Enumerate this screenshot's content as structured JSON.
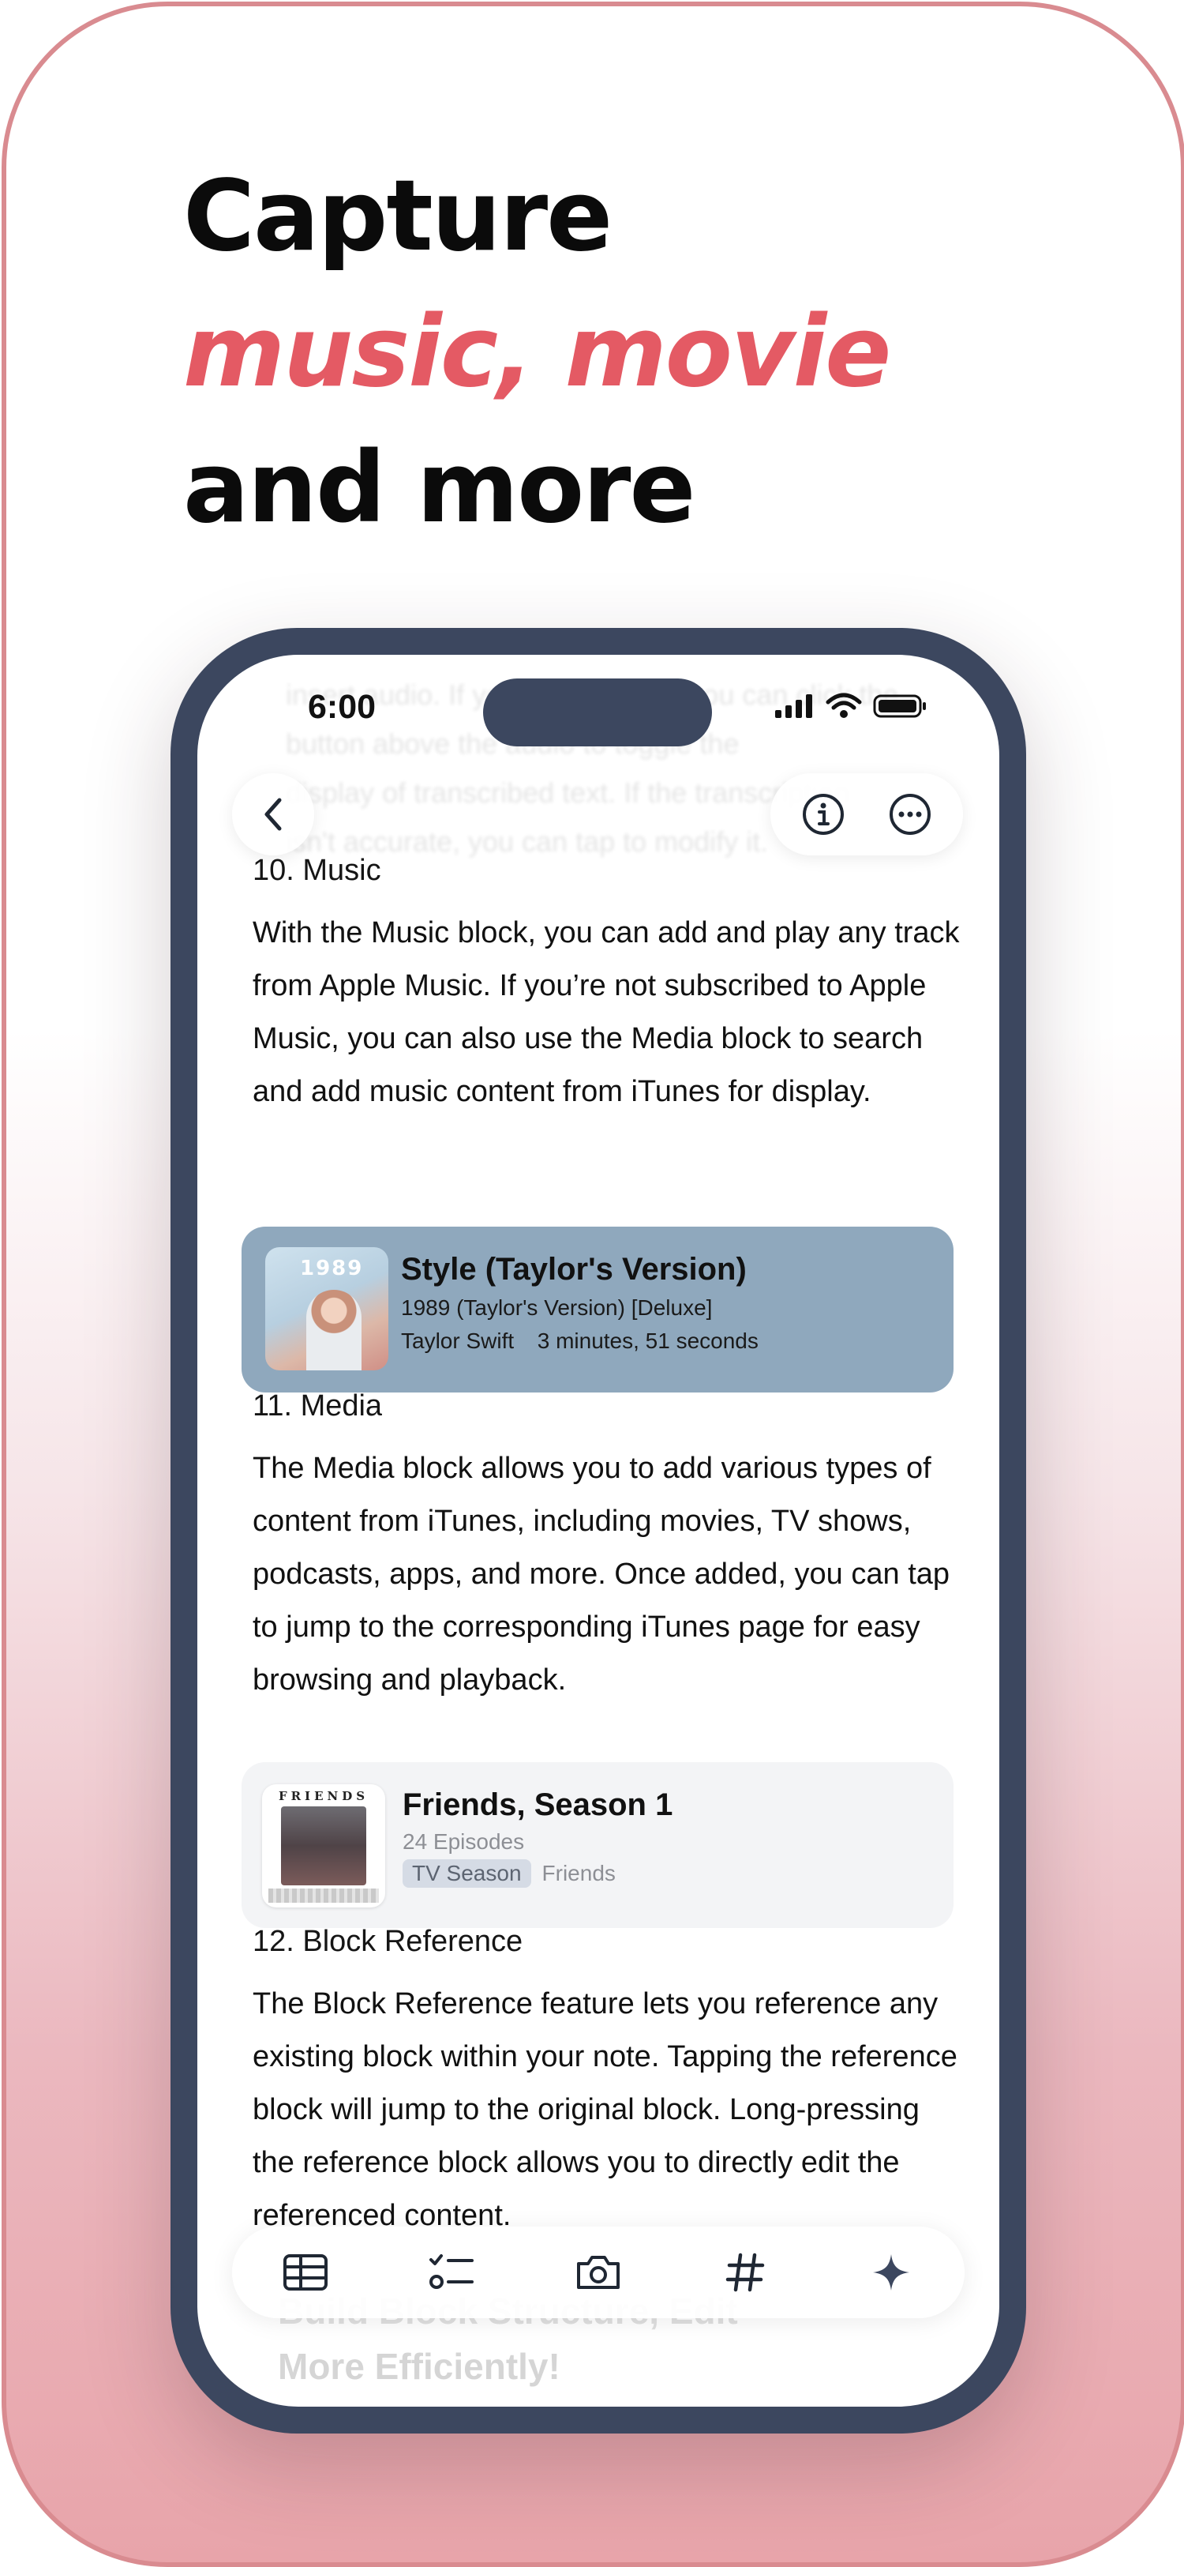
{
  "headline": {
    "line1": "Capture",
    "line2": "music, movie",
    "line3": "and more"
  },
  "status_bar": {
    "time": "6:00"
  },
  "ghost_text": {
    "lines": [
      "insert audio. If you insert audio, you can click the",
      "button above the audio to toggle the",
      "display of transcribed text. If the transcription",
      "isn't accurate, you can tap to modify it."
    ],
    "bottom_line1": "Build Block Structure, Edit",
    "bottom_line2": "More Efficiently!"
  },
  "sections": [
    {
      "title": "10. Music",
      "body": "With the Music block, you can add and play any track from Apple Music. If you’re not subscribed to Apple Music, you can also use the Media block to search and add music content from iTunes for display."
    },
    {
      "title": "11.  Media",
      "body": "The Media block allows you to add various types of content from iTunes, including movies, TV shows, podcasts, apps, and more. Once added, you can tap to jump to the corresponding iTunes page for easy browsing and playback."
    },
    {
      "title": "12. Block Reference",
      "body": "The Block Reference feature lets you reference any existing block within your note. Tapping the reference block will jump to the original block. Long-pressing the reference block allows you to directly edit the referenced content."
    }
  ],
  "music_card": {
    "title": "Style (Taylor's Version)",
    "album": "1989 (Taylor's Version) [Deluxe]",
    "artist": "Taylor Swift",
    "duration": "3 minutes, 51 seconds",
    "art_text": "1989",
    "color": "#8fa8bd"
  },
  "media_card": {
    "title": "Friends, Season 1",
    "episodes": "24 Episodes",
    "tag": "TV Season",
    "series": "Friends",
    "art_text": "FRIENDS"
  },
  "nav": {
    "back_icon": "chevron-left-icon",
    "info_icon": "info-circle-icon",
    "more_icon": "ellipsis-circle-icon"
  },
  "toolbar": {
    "items": [
      "table-icon",
      "checklist-icon",
      "camera-icon",
      "hashtag-icon",
      "sparkle-icon"
    ]
  },
  "colors": {
    "accent": "#e45a64",
    "phone_frame": "#3c475f",
    "page_border": "#d98b90"
  }
}
